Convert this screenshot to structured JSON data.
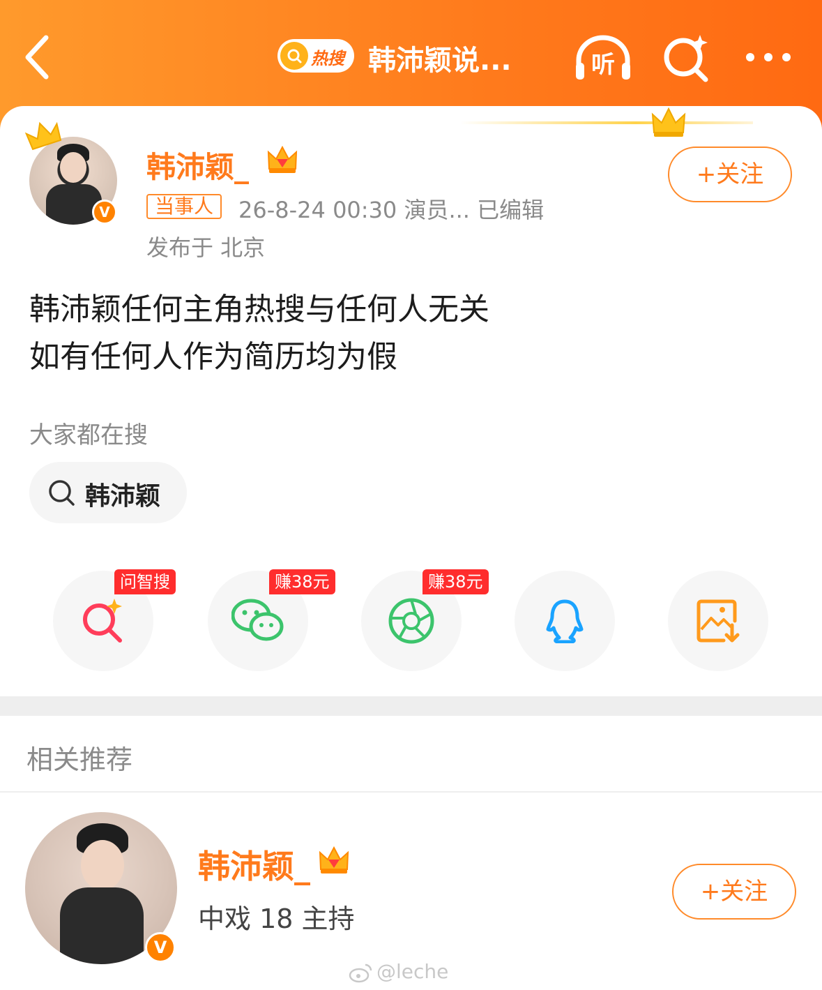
{
  "header": {
    "hot_badge": "热搜",
    "title": "韩沛颖说...",
    "listen_label": "听"
  },
  "post": {
    "author": "韩沛颖_",
    "party_tag": "当事人",
    "meta": "26-8-24 00:30  演员...  已编辑",
    "location": "发布于 北京",
    "follow_label": "+关注",
    "content_line1": "韩沛颖任何主角热搜与任何人无关",
    "content_line2": "如有任何人作为简历均为假",
    "verified_mark": "V"
  },
  "searching": {
    "label": "大家都在搜",
    "chip": "韩沛颖"
  },
  "share": {
    "items": [
      {
        "name": "ask-search",
        "ribbon": "问智搜"
      },
      {
        "name": "wechat",
        "ribbon": "赚38元"
      },
      {
        "name": "moments",
        "ribbon": "赚38元"
      },
      {
        "name": "qq",
        "ribbon": ""
      },
      {
        "name": "save-image",
        "ribbon": ""
      }
    ]
  },
  "related": {
    "label": "相关推荐",
    "user": "韩沛颖_",
    "desc": "中戏 18 主持",
    "follow_label": "+关注",
    "verified_mark": "V"
  },
  "watermark": "@leche",
  "colors": {
    "brand_orange": "#ff7a1c",
    "ribbon_red": "#ff2d2d",
    "wechat_green": "#3cc46c",
    "qq_blue": "#1aa3ff"
  }
}
